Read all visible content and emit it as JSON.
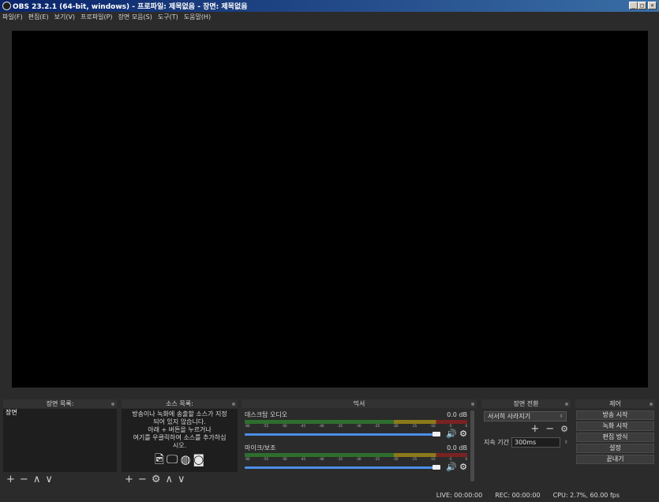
{
  "window": {
    "title": "OBS 23.2.1 (64-bit, windows) - 프로파일: 제목없음 - 장면: 제목없음",
    "minimize_glyph": "_",
    "maximize_glyph": "□",
    "close_glyph": "×"
  },
  "menu": [
    "파일(F)",
    "편집(E)",
    "보기(V)",
    "프로파일(P)",
    "장면 모음(S)",
    "도구(T)",
    "도움말(H)"
  ],
  "docks": {
    "scenes": {
      "title": "장면 목록",
      "items": [
        "장면"
      ]
    },
    "sources": {
      "title": "소스 목록",
      "hint_lines": [
        "방송이나 녹화에 송출할 소스가 지정",
        "되어 있지 않습니다.",
        "아래 + 버튼을 누르거나",
        "여기를 우클릭하여 소스를 추가하십",
        "시오."
      ]
    },
    "mixer": {
      "title": "믹서",
      "ticks": [
        "-60",
        "-55",
        "-50",
        "-45",
        "-40",
        "-35",
        "-30",
        "-25",
        "-20",
        "-15",
        "-10",
        "-5",
        "0"
      ],
      "channels": [
        {
          "name": "데스크탑 오디오",
          "level": "0.0 dB",
          "volume": 0.93
        },
        {
          "name": "마이크/보조",
          "level": "0.0 dB",
          "volume": 0.93
        }
      ]
    },
    "transitions": {
      "title": "장면 전환",
      "selected": "서서히 사라지기",
      "duration_label": "지속 기간",
      "duration_value": "300ms"
    },
    "controls": {
      "title": "제어",
      "buttons": [
        "방송 시작",
        "녹화 시작",
        "편집 방식",
        "설정",
        "끝내기"
      ]
    }
  },
  "status": {
    "live": "LIVE: 00:00:00",
    "rec": "REC: 00:00:00",
    "cpu": "CPU: 2.7%, 60.00 fps"
  },
  "colors": {
    "preview_bg": "#000000",
    "app_bg": "#2b2b2b",
    "fader": "#4b8ee8"
  },
  "icons": [
    "plus-icon",
    "minus-icon",
    "up-arrow-icon",
    "down-arrow-icon",
    "gear-icon",
    "image-icon",
    "monitor-icon",
    "globe-icon",
    "camera-icon",
    "speaker-icon"
  ]
}
